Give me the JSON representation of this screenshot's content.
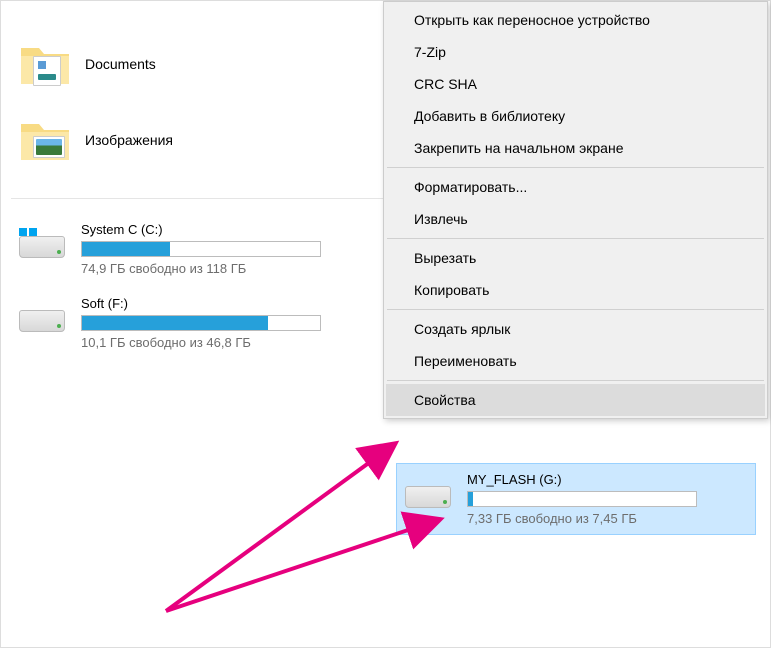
{
  "folders": {
    "documents": "Documents",
    "images": "Изображения"
  },
  "drives": {
    "system": {
      "name": "System C (C:)",
      "status": "74,9 ГБ свободно из 118 ГБ",
      "fill_percent": 37
    },
    "soft": {
      "name": "Soft (F:)",
      "status": "10,1 ГБ свободно из 46,8 ГБ",
      "fill_percent": 78
    },
    "flash": {
      "name": "MY_FLASH (G:)",
      "status": "7,33 ГБ свободно из 7,45 ГБ",
      "fill_percent": 2
    }
  },
  "context_menu": {
    "portable": "Открыть как переносное устройство",
    "sevenzip": "7-Zip",
    "crcsha": "CRC SHA",
    "library": "Добавить в библиотеку",
    "pin_start": "Закрепить на начальном экране",
    "format": "Форматировать...",
    "eject": "Извлечь",
    "cut": "Вырезать",
    "copy": "Копировать",
    "shortcut": "Создать ярлык",
    "rename": "Переименовать",
    "properties": "Свойства"
  }
}
